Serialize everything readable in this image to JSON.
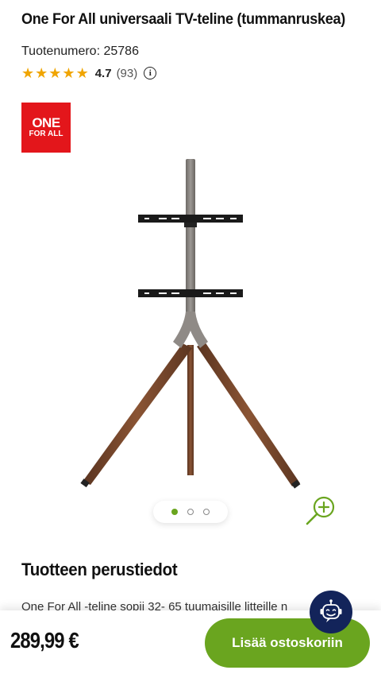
{
  "product": {
    "title": "One For All universaali TV-teline (tummanruskea)",
    "sku_label": "Tuotenumero:",
    "sku_value": "25786",
    "rating": "4.7",
    "review_count": "(93)",
    "info_glyph": "i",
    "stars": [
      "★",
      "★",
      "★",
      "★",
      "★"
    ]
  },
  "brand": {
    "logo_line1": "ONE",
    "logo_line2": "FOR ALL",
    "logo_color": "#e3161b"
  },
  "gallery": {
    "active_index": 1,
    "total": 3,
    "zoom_icon": "zoom-in-icon"
  },
  "details": {
    "section_title": "Tuotteen perustiedot",
    "description": "One For All -teline sopii 32- 65 tuumaisille litteille n"
  },
  "footer": {
    "price": "289,99 €",
    "add_to_cart": "Lisää ostoskoriin",
    "chat_icon": "robot-assistant-icon"
  },
  "colors": {
    "accent": "#6aa51f",
    "star": "#f0a500",
    "assistant": "#13245a"
  }
}
